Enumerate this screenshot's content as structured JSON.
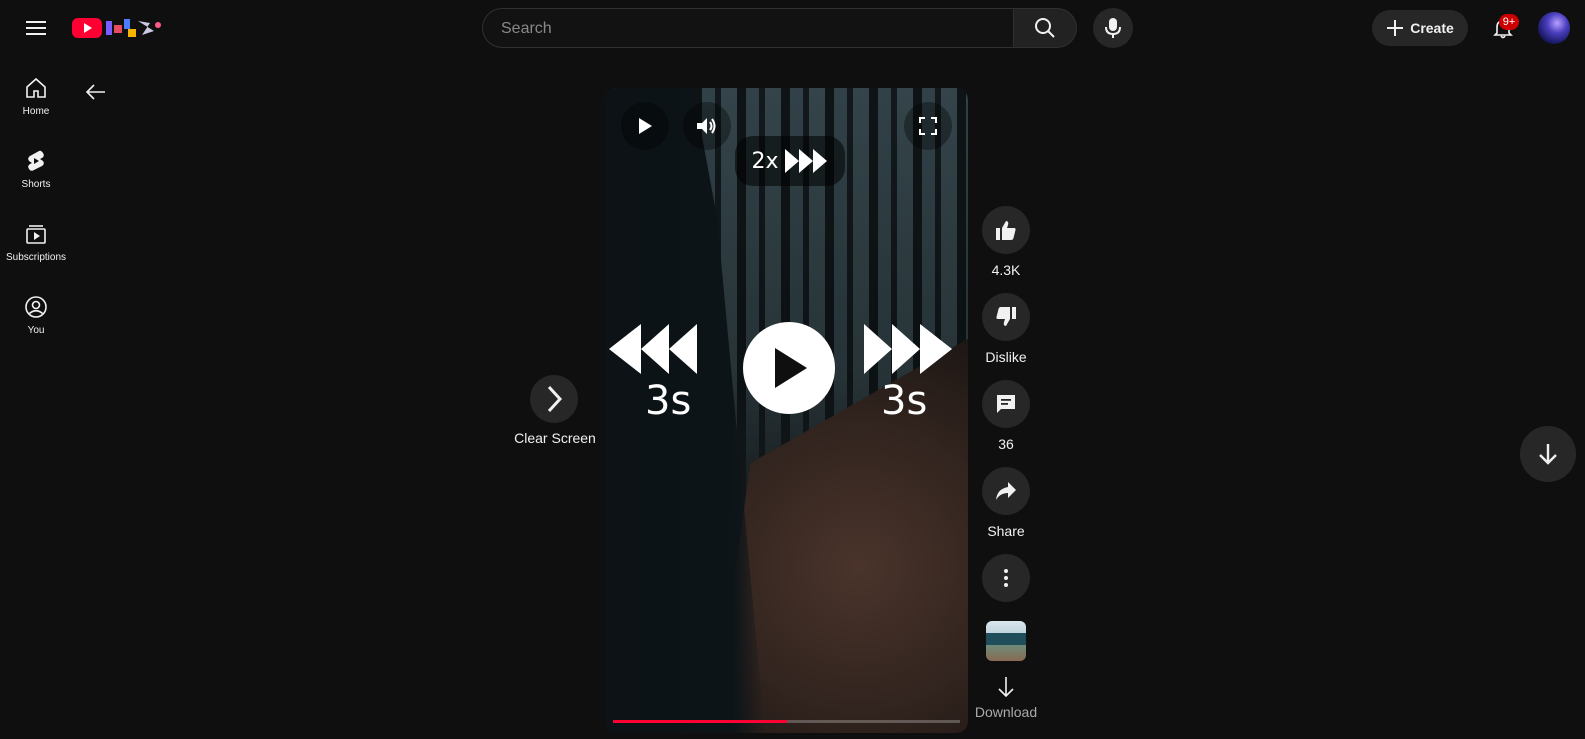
{
  "header": {
    "menu_icon": "hamburger-menu-icon",
    "logo_icon": "youtube-logo-icon",
    "search_placeholder": "Search",
    "create_label": "Create",
    "notification_count": "9+"
  },
  "sidebar": {
    "items": [
      {
        "label": "Home",
        "icon": "home-icon"
      },
      {
        "label": "Shorts",
        "icon": "shorts-icon"
      },
      {
        "label": "Subscriptions",
        "icon": "subscriptions-icon"
      },
      {
        "label": "You",
        "icon": "account-circle-icon"
      }
    ]
  },
  "player": {
    "speed_label": "2x",
    "skip_back_label": "3s",
    "skip_forward_label": "3s",
    "progress_fraction": 0.5,
    "clear_screen_label": "Clear Screen"
  },
  "actions": {
    "like_count": "4.3K",
    "dislike_label": "Dislike",
    "comment_count": "36",
    "share_label": "Share",
    "download_label": "Download"
  },
  "colors": {
    "background": "#0f0f0f",
    "accent": "#ff0033",
    "button_bg": "#272727"
  }
}
